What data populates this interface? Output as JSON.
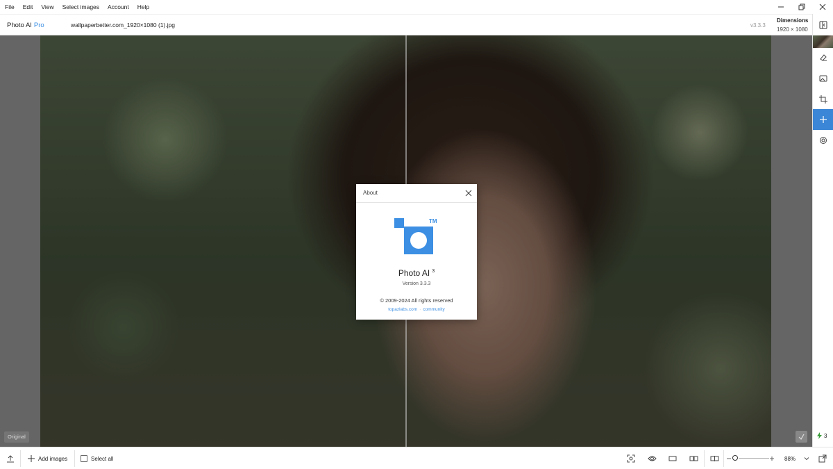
{
  "menubar": {
    "items": [
      {
        "label": "File"
      },
      {
        "label": "Edit"
      },
      {
        "label": "View"
      },
      {
        "label": "Select images"
      },
      {
        "label": "Account"
      },
      {
        "label": "Help"
      }
    ]
  },
  "header": {
    "app_name": "Photo AI",
    "plan": "Pro",
    "filename": "wallpaperbetter.com_1920×1080 (1).jpg",
    "version": "v3.3.3",
    "dimensions_label": "Dimensions",
    "dimensions_value": "1920 × 1080"
  },
  "canvas": {
    "original_tag": "Original",
    "credits": "3"
  },
  "bottombar": {
    "add_images": "Add images",
    "select_all": "Select all",
    "zoom": "88%"
  },
  "about": {
    "title": "About",
    "trademark": "TM",
    "product": "Photo AI",
    "major": "3",
    "version": "Version 3.3.3",
    "copyright": "© 2009-2024 All rights reserved",
    "link_site": "topazlabs.com",
    "link_community": "community"
  },
  "colors": {
    "accent": "#3c8fe3",
    "active_tool": "#3b86d6"
  }
}
